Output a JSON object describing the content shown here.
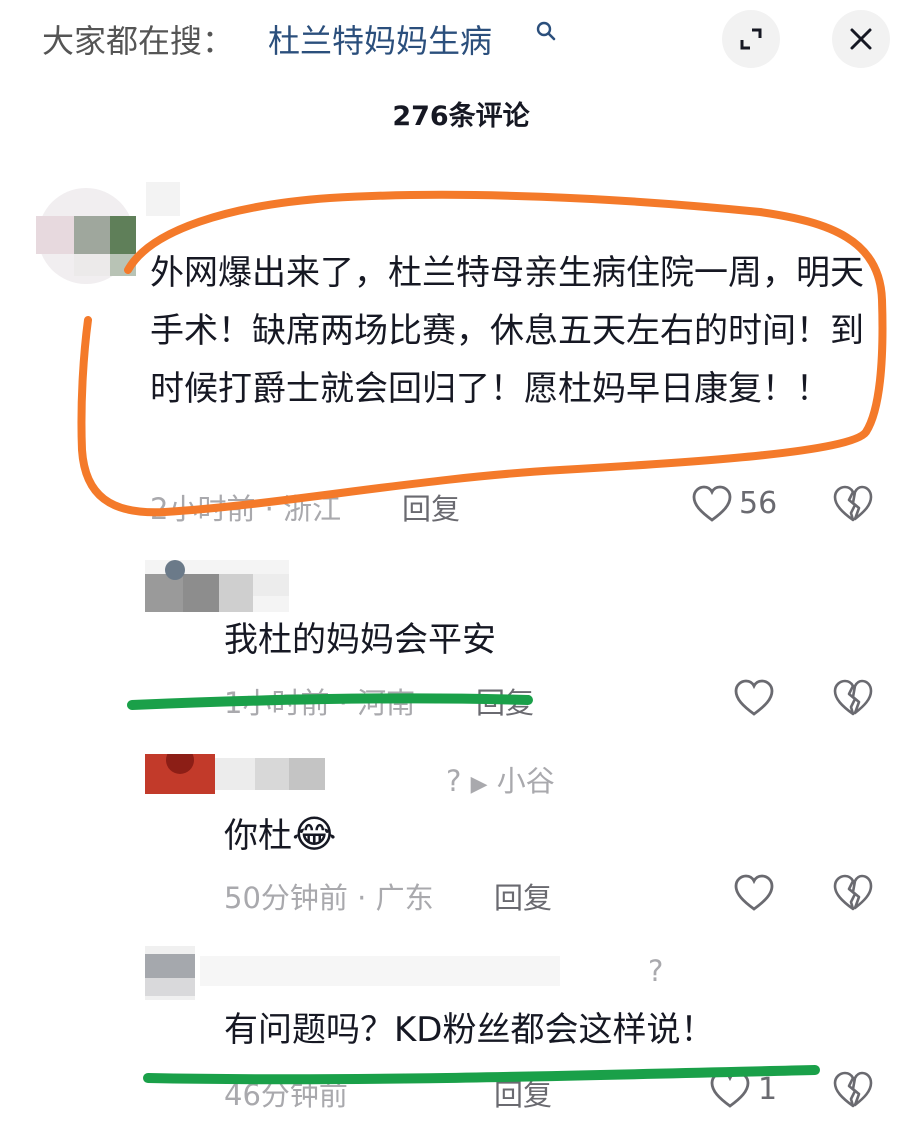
{
  "search": {
    "prefix": "大家都在搜：",
    "term": "杜兰特妈妈生病"
  },
  "header": {
    "comment_count": "276条评论"
  },
  "comments": [
    {
      "text": "外网爆出来了，杜兰特母亲生病住院一周，明天手术！缺席两场比赛，休息五天左右的时间！到时候打爵士就会回归了！愿杜妈早日康复！！",
      "time": "2小时前",
      "location": "浙江",
      "reply_label": "回复",
      "likes": "56"
    },
    {
      "text": "我杜的妈妈会平安",
      "time": "1小时前",
      "location": "河南",
      "reply_label": "回复",
      "likes": ""
    },
    {
      "reply_to": "小谷",
      "text": "你杜",
      "emoji": "😂",
      "time": "50分钟前",
      "location": "广东",
      "reply_label": "回复",
      "likes": ""
    },
    {
      "text": "有问题吗？KD粉丝都会这样说！",
      "time": "46分钟前",
      "reply_label": "回复",
      "likes": "1"
    }
  ],
  "icons": {
    "search": "search-icon",
    "expand": "expand-icon",
    "close": "close-icon",
    "like": "heart-outline-icon",
    "dislike": "broken-heart-icon"
  },
  "colors": {
    "accent_link": "#2b4f7c",
    "annotation_orange": "#f47a2a",
    "annotation_green": "#1aa049",
    "meta_gray": "#a9a9ad"
  }
}
